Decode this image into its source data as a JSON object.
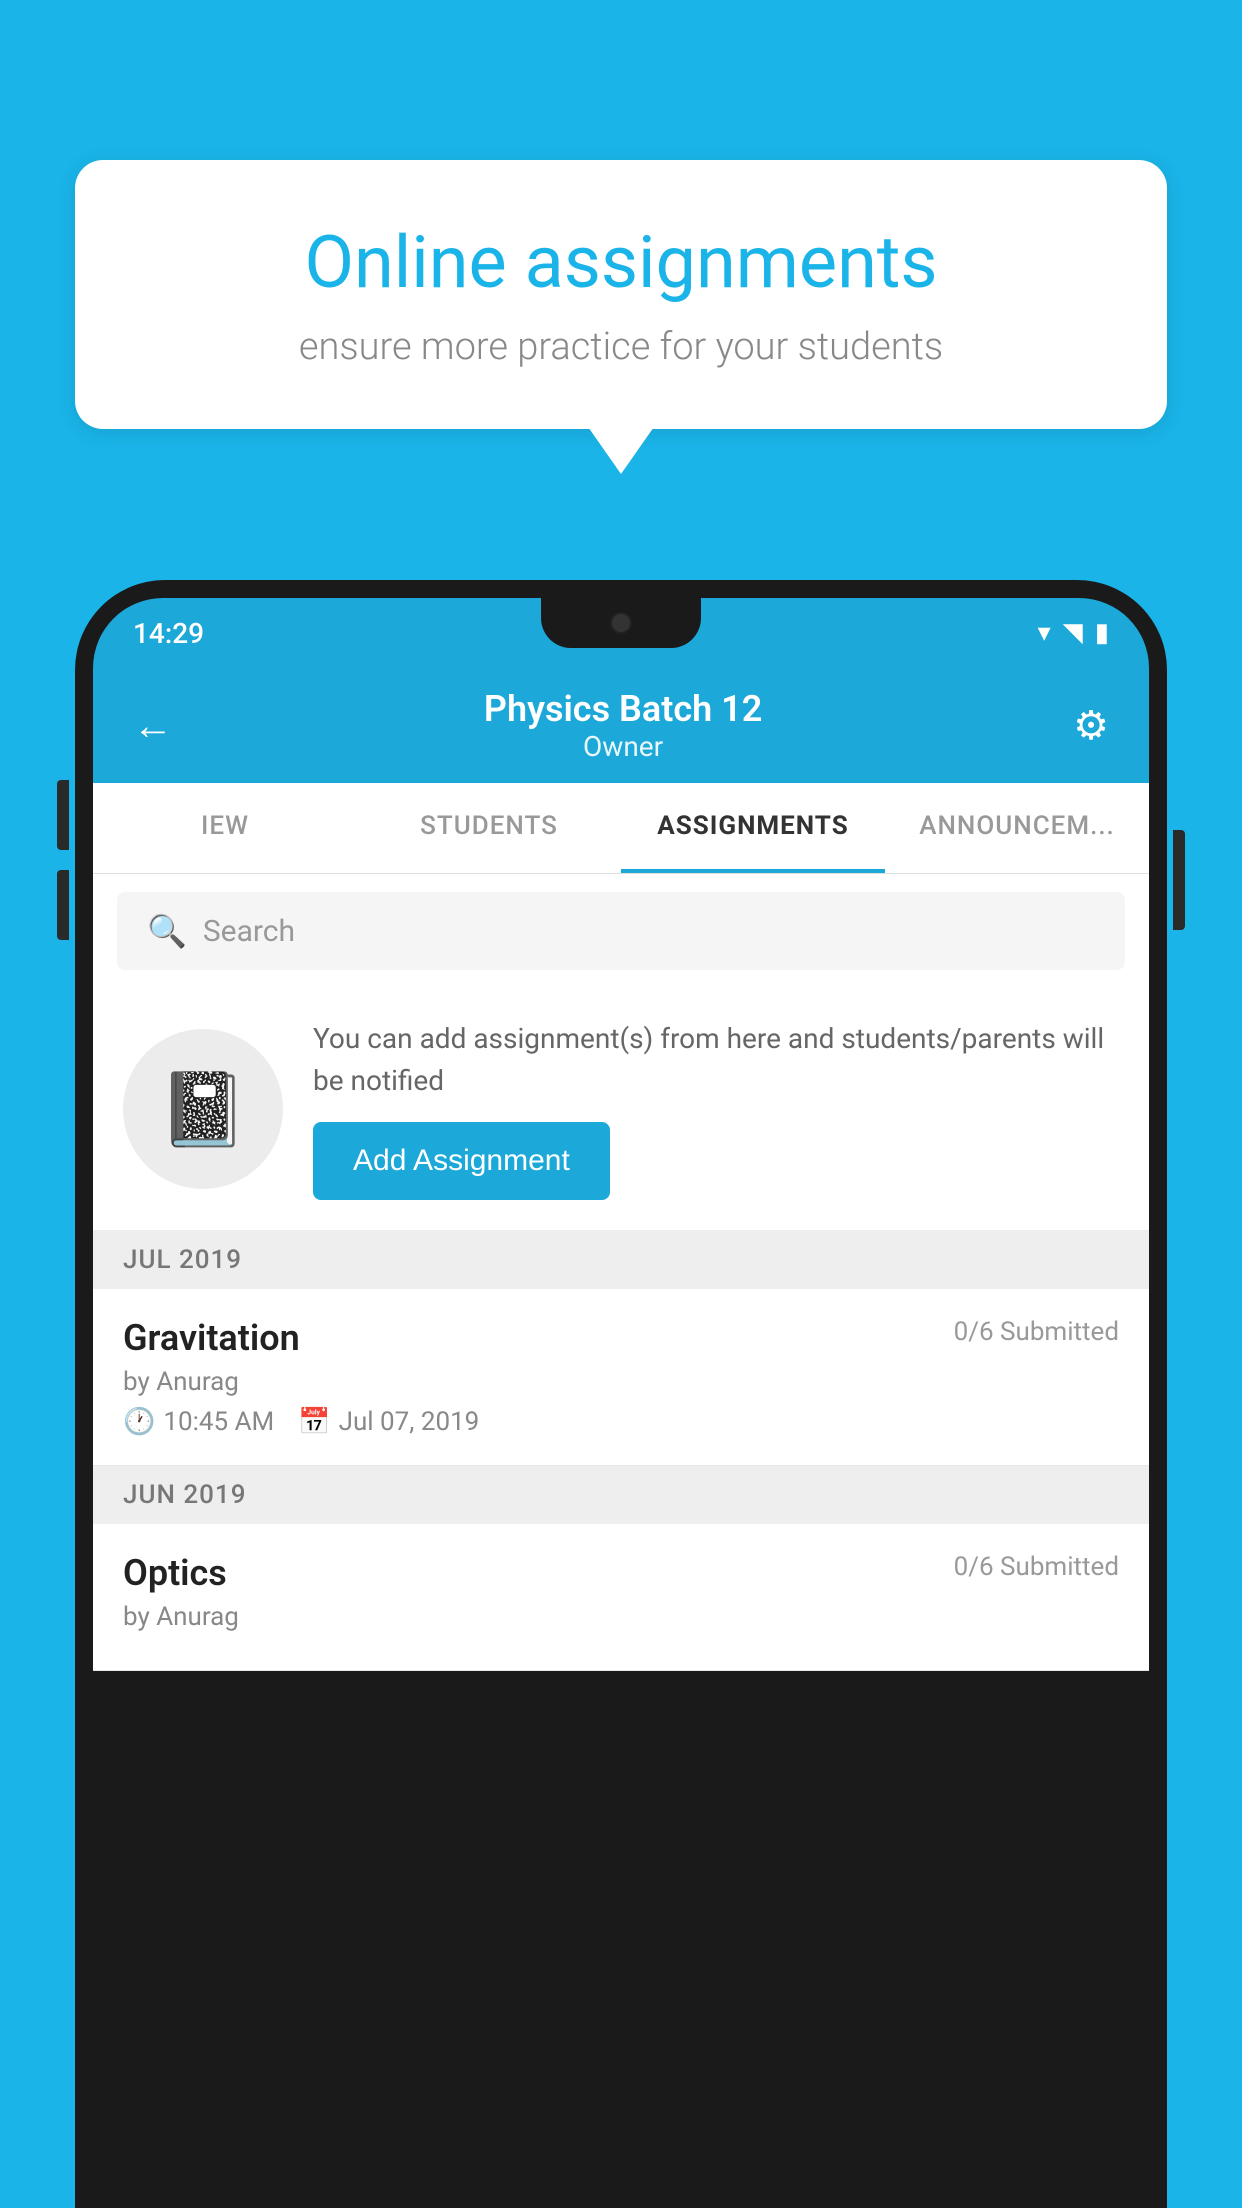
{
  "background": {
    "color": "#1ab4e8"
  },
  "speech_bubble": {
    "title": "Online assignments",
    "subtitle": "ensure more practice for your students"
  },
  "phone": {
    "status_bar": {
      "time": "14:29",
      "wifi": "▾",
      "signal": "▴",
      "battery": "▪"
    },
    "header": {
      "title": "Physics Batch 12",
      "subtitle": "Owner",
      "back_label": "←",
      "settings_label": "⚙"
    },
    "tabs": [
      {
        "label": "IEW",
        "active": false
      },
      {
        "label": "STUDENTS",
        "active": false
      },
      {
        "label": "ASSIGNMENTS",
        "active": true
      },
      {
        "label": "ANNOUNCEM...",
        "active": false
      }
    ],
    "search": {
      "placeholder": "Search"
    },
    "promo": {
      "description": "You can add assignment(s) from here and students/parents will be notified",
      "button_label": "Add Assignment"
    },
    "sections": [
      {
        "header": "JUL 2019",
        "assignments": [
          {
            "name": "Gravitation",
            "submitted": "0/6 Submitted",
            "by": "by Anurag",
            "time": "10:45 AM",
            "date": "Jul 07, 2019"
          }
        ]
      },
      {
        "header": "JUN 2019",
        "assignments": [
          {
            "name": "Optics",
            "submitted": "0/6 Submitted",
            "by": "by Anurag",
            "time": "",
            "date": ""
          }
        ]
      }
    ]
  }
}
